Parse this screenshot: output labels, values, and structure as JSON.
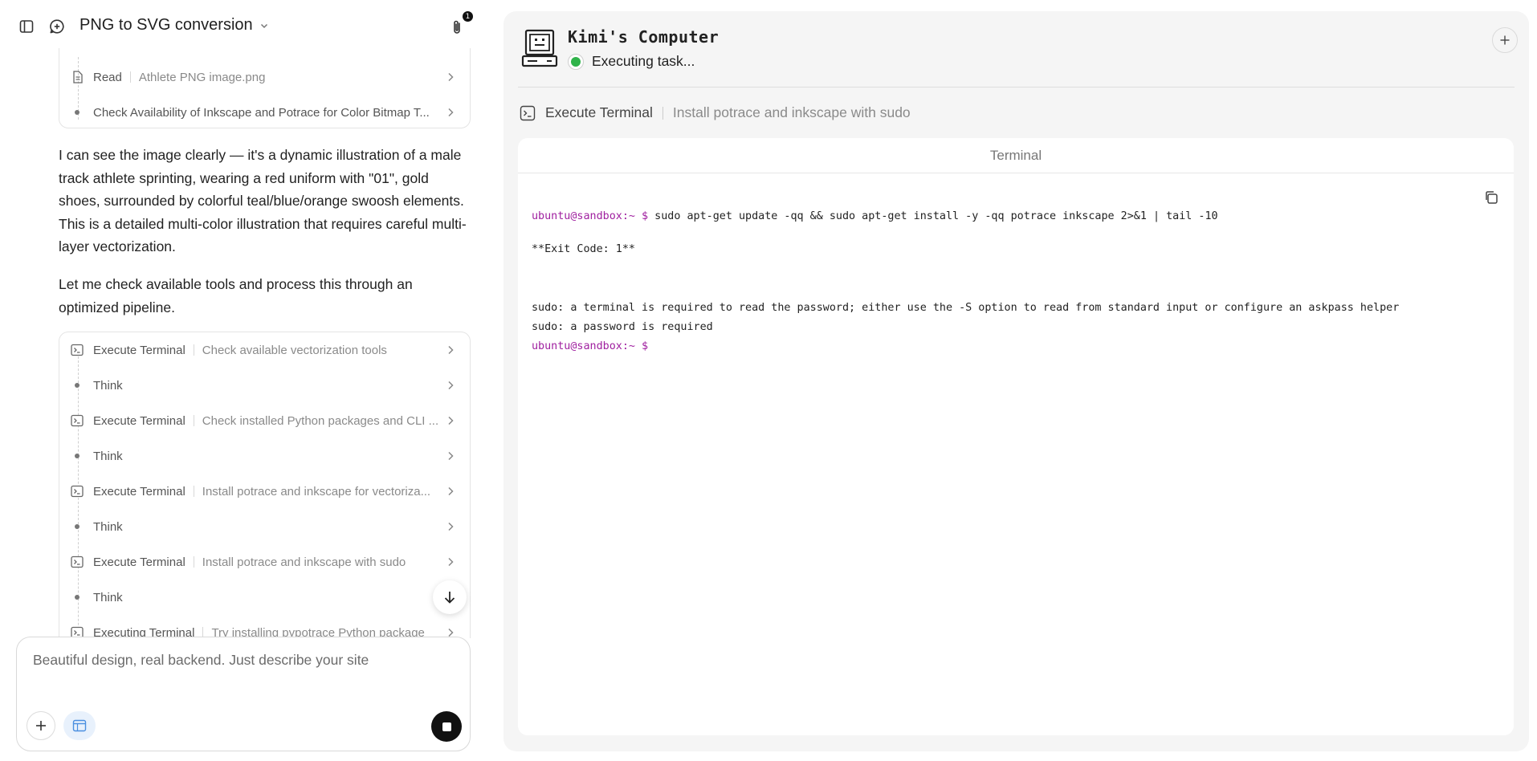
{
  "header": {
    "title": "PNG to SVG conversion",
    "attachment_count": "1"
  },
  "card1": {
    "steps": [
      {
        "name": "Read",
        "desc": "Athlete PNG image.png"
      },
      {
        "name": "Check Availability of Inkscape and Potrace for Color Bitmap T...",
        "desc": ""
      }
    ]
  },
  "message": {
    "paragraph1": "I can see the image clearly — it's a dynamic illustration of a male track athlete sprinting, wearing a red uniform with \"01\", gold shoes, surrounded by colorful teal/blue/orange swoosh elements. This is a detailed multi-color illustration that requires careful multi-layer vectorization.",
    "paragraph2": "Let me check available tools and process this through an optimized pipeline."
  },
  "card2": {
    "steps": [
      {
        "type": "terminal",
        "name": "Execute Terminal",
        "desc": "Check available vectorization tools"
      },
      {
        "type": "think",
        "name": "Think",
        "desc": ""
      },
      {
        "type": "terminal",
        "name": "Execute Terminal",
        "desc": "Check installed Python packages and CLI ..."
      },
      {
        "type": "think",
        "name": "Think",
        "desc": ""
      },
      {
        "type": "terminal",
        "name": "Execute Terminal",
        "desc": "Install potrace and inkscape for vectoriza..."
      },
      {
        "type": "think",
        "name": "Think",
        "desc": ""
      },
      {
        "type": "terminal",
        "name": "Execute Terminal",
        "desc": "Install potrace and inkscape with sudo"
      },
      {
        "type": "think",
        "name": "Think",
        "desc": ""
      },
      {
        "type": "terminal",
        "name": "Executing Terminal",
        "desc": "Try installing pypotrace Python package"
      }
    ]
  },
  "input": {
    "placeholder": "Beautiful design, real backend. Just describe your site"
  },
  "computer": {
    "title": "Kimi's Computer",
    "status": "Executing task...",
    "action_name": "Execute Terminal",
    "action_desc": "Install potrace and inkscape with sudo",
    "terminal_title": "Terminal",
    "lines": [
      {
        "prompt": "ubuntu@sandbox:~ $",
        "text": " sudo apt-get update -qq && sudo apt-get install -y -qq potrace inkscape 2>&1 | tail -10"
      },
      {
        "prompt": "",
        "text": "**Exit Code: 1**"
      },
      {
        "prompt": "",
        "text": "sudo: a terminal is required to read the password; either use the -S option to read from standard input or configure an askpass helper"
      },
      {
        "prompt": "",
        "text": "sudo: a password is required"
      },
      {
        "prompt": "ubuntu@sandbox:~ $",
        "text": ""
      }
    ]
  }
}
